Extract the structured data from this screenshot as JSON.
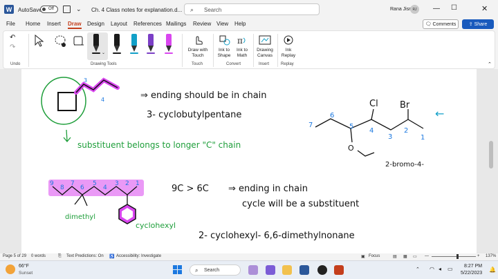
{
  "titlebar": {
    "logo": "W",
    "autosave_label": "AutoSave",
    "autosave_state": "Off",
    "qat_more": "⌄",
    "doc_title": "Ch. 4 Class notes for explanation.d...",
    "search_placeholder": "Search",
    "user_name": "Rana Jisr",
    "user_initials": "RJ"
  },
  "menu": [
    "File",
    "Home",
    "Insert",
    "Draw",
    "Design",
    "Layout",
    "References",
    "Mailings",
    "Review",
    "View",
    "Help"
  ],
  "menu_active": "Draw",
  "buttons": {
    "comments": "Comments",
    "share": "Share"
  },
  "ribbon": {
    "groups": {
      "undo": "Undo",
      "drawing_tools": "Drawing Tools",
      "touch": "Touch",
      "convert": "Convert",
      "insert": "Insert",
      "replay": "Replay"
    },
    "draw_with_touch": "Draw with Touch",
    "ink_to_shape": "Ink to Shape",
    "ink_to_math": "Ink to Math",
    "drawing_canvas": "Drawing Canvas",
    "ink_replay": "Ink Replay",
    "pen_colors": [
      "#1a1a1a",
      "#1a1a1a",
      "#12a0c8",
      "#1b78e0",
      "#7b3fc6",
      "#d946ef"
    ]
  },
  "notes": {
    "n3": "3",
    "n4a": "4",
    "ending_in_chain": "⇒ ending should be in chain",
    "cyclobutylpentane": "3- cyclobutylpentane",
    "substituent_note": "substituent belongs to longer \"C\" chain",
    "cl": "Cl",
    "br": "Br",
    "c7": "7",
    "c6": "6",
    "c5": "5",
    "c4": "4",
    "c3": "3",
    "c2": "2",
    "c1": "1",
    "bromo": "2-bromo-4-",
    "arrow_left": "←",
    "chain_numbers": [
      "9",
      "8",
      "7",
      "6",
      "5",
      "4",
      "3",
      "2",
      "1"
    ],
    "nine_vs_six": "9C > 6C",
    "ending_in_chain2": "⇒ ending in chain",
    "cycle_sub": "cycle will be a substituent",
    "dimethyl": "dimethyl",
    "cyclohexyl": "cyclohexyl",
    "final_name": "2- cyclohexyl- 6,6-dimethylnonane"
  },
  "status": {
    "page": "Page 5 of 29",
    "words": "0 words",
    "text_predictions": "Text Predictions: On",
    "accessibility": "Accessibility: Investigate",
    "focus": "Focus",
    "zoom": "137%"
  },
  "taskbar": {
    "temp": "66°F",
    "weather": "Sunset",
    "search": "Search",
    "time": "8:27 PM",
    "date": "5/22/2023"
  }
}
